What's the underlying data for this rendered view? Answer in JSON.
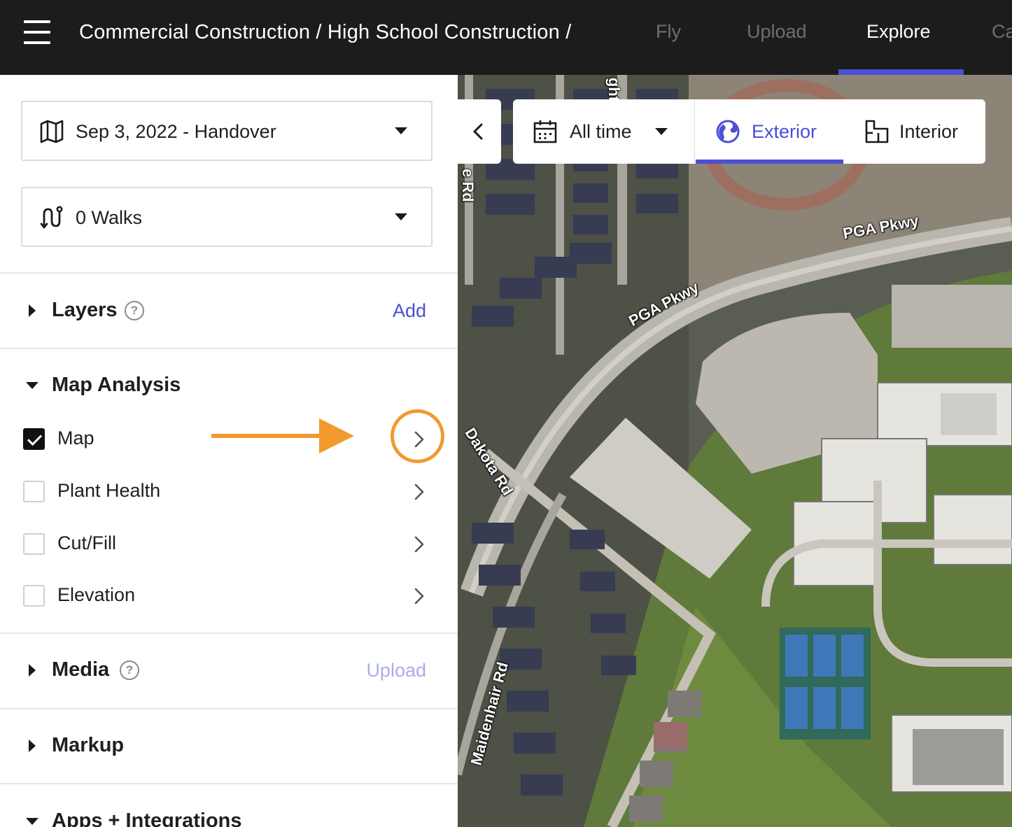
{
  "header": {
    "breadcrumb": "Commercial Construction / High School Construction /",
    "tabs": [
      {
        "label": "Fly"
      },
      {
        "label": "Upload"
      },
      {
        "label": "Explore"
      },
      {
        "label": "Ca"
      }
    ],
    "active_tab": "Explore"
  },
  "sidebar": {
    "date_select": {
      "label": "Sep 3, 2022 - Handover"
    },
    "walks_select": {
      "label": "0 Walks"
    },
    "layers": {
      "title": "Layers",
      "action": "Add"
    },
    "map_analysis": {
      "title": "Map Analysis",
      "items": [
        {
          "label": "Map",
          "checked": true
        },
        {
          "label": "Plant Health",
          "checked": false
        },
        {
          "label": "Cut/Fill",
          "checked": false
        },
        {
          "label": "Elevation",
          "checked": false
        }
      ]
    },
    "media": {
      "title": "Media",
      "action": "Upload"
    },
    "markup": {
      "title": "Markup"
    },
    "apps": {
      "title": "Apps + Integrations"
    }
  },
  "map": {
    "toolbar": {
      "time_label": "All time",
      "exterior_label": "Exterior",
      "interior_label": "Interior"
    },
    "road_labels": [
      "PGA Pkwy",
      "PGA Pkwy",
      "Dakota Rd",
      "Maidenhair Rd",
      "e Rd",
      "ght"
    ]
  },
  "colors": {
    "accent": "#4a4fd6",
    "accent_muted": "#a9acec",
    "header_bg": "#1c1c1c",
    "annotation": "#f29a2e"
  }
}
